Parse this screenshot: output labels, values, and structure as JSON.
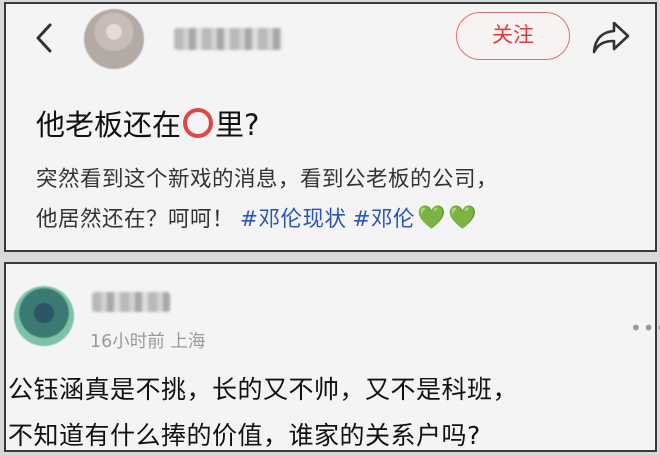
{
  "post": {
    "follow_label": "关注",
    "title_before": "他老板还在",
    "title_after": "里?",
    "body_line1": "突然看到这个新戏的消息，看到公老板的公司，",
    "body_line2_text": "他居然还在？呵呵！",
    "tags": [
      "#邓伦现状",
      "#邓伦"
    ],
    "hearts": [
      "💚",
      "💚"
    ]
  },
  "comment": {
    "meta": "16小时前 上海",
    "more": "•••",
    "line1": "公钰涵真是不挑，长的又不帅，又不是科班，",
    "line2": "不知道有什么捧的价值，谁家的关系户吗?"
  },
  "icons": {
    "back": "chevron-left-icon",
    "share": "share-arrow-icon",
    "more": "more-dots-icon",
    "title_symbol": "red-circle-icon"
  },
  "colors": {
    "follow": "#e03a3a",
    "hashtag": "#2a55b8",
    "heart": "#6cc04a"
  }
}
